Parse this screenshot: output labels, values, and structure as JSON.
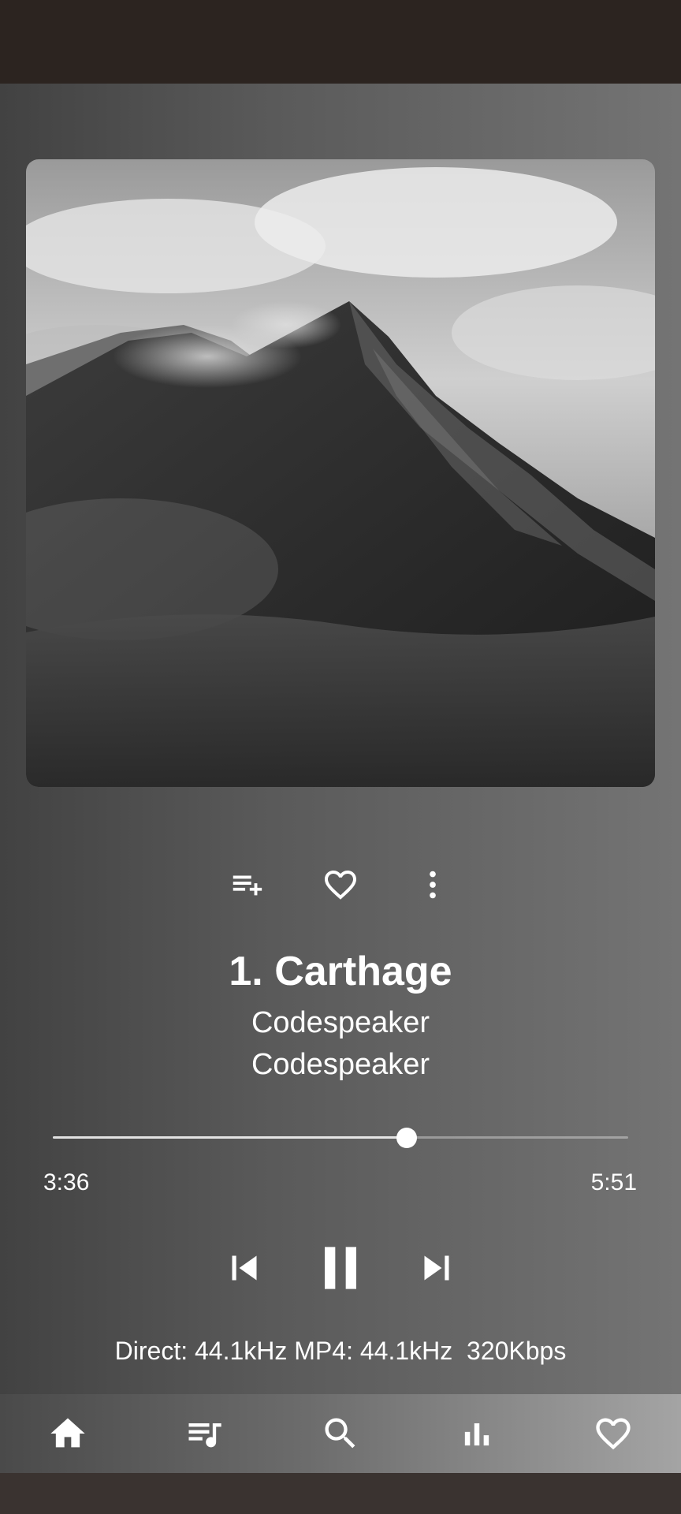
{
  "album_art": {
    "icon": "mountain-album-cover"
  },
  "actions": [
    {
      "name": "add-to-playlist",
      "icon": "playlist-add-icon"
    },
    {
      "name": "favorite",
      "icon": "heart-outline-icon"
    },
    {
      "name": "more-options",
      "icon": "more-vert-icon"
    }
  ],
  "track": {
    "title": "1. Carthage",
    "artist": "Codespeaker",
    "album": "Codespeaker"
  },
  "playback": {
    "elapsed": "3:36",
    "total": "5:51",
    "progress_fraction": 0.615,
    "state": "playing"
  },
  "controls": [
    {
      "name": "previous",
      "icon": "skip-previous-icon"
    },
    {
      "name": "pause",
      "icon": "pause-icon"
    },
    {
      "name": "next",
      "icon": "skip-next-icon"
    }
  ],
  "audio_info": "Direct: 44.1kHz MP4: 44.1kHz  320Kbps",
  "bottom_nav": [
    {
      "name": "home",
      "icon": "home-icon"
    },
    {
      "name": "queue",
      "icon": "queue-music-icon"
    },
    {
      "name": "search",
      "icon": "search-icon"
    },
    {
      "name": "stats",
      "icon": "bar-chart-icon"
    },
    {
      "name": "favorites",
      "icon": "heart-icon"
    }
  ],
  "colors": {
    "status_bar": "#2c2420",
    "background_left": "#424242",
    "background_right": "#747474",
    "accent": "#ffffff"
  }
}
